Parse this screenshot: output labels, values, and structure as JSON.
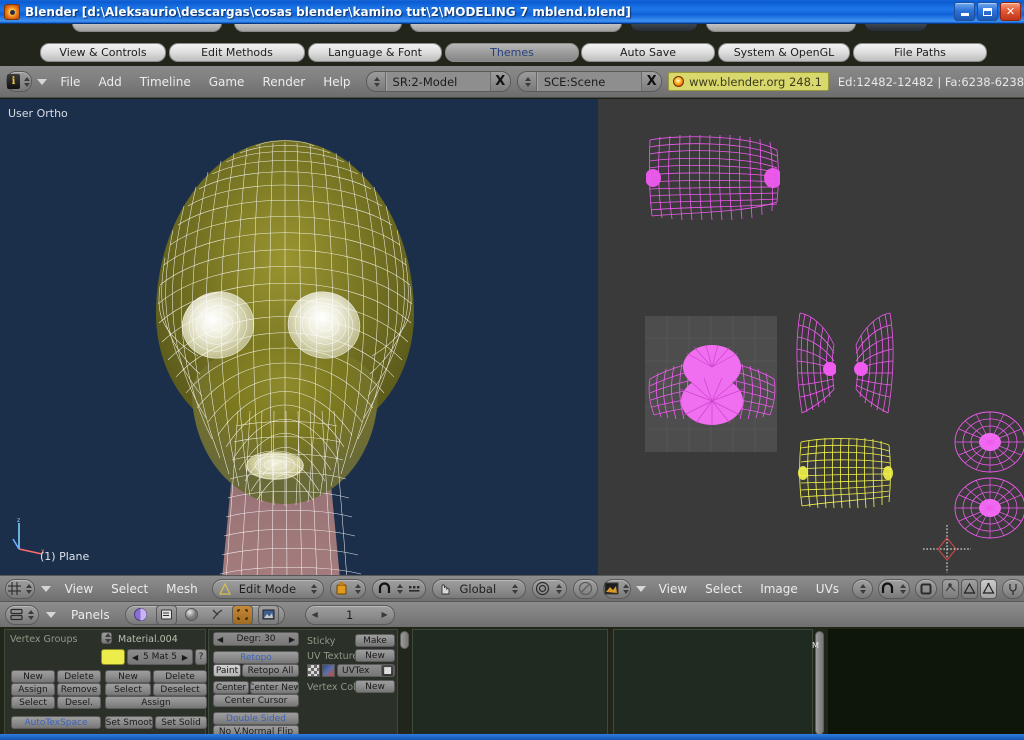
{
  "window": {
    "title": "Blender [d:\\Aleksaurio\\descargas\\cosas blender\\kamino tut\\2\\MODELING 7 mblend.blend]",
    "app_icon": "blender-logo-icon",
    "controls": {
      "minimize": "minimize-button",
      "restore": "restore-button",
      "close": "✕"
    }
  },
  "prefs_tabs": {
    "items": [
      {
        "label": "View & Controls",
        "active": false
      },
      {
        "label": "Edit Methods",
        "active": false
      },
      {
        "label": "Language & Font",
        "active": false
      },
      {
        "label": "Themes",
        "active": true
      },
      {
        "label": "Auto Save",
        "active": false
      },
      {
        "label": "System & OpenGL",
        "active": false
      },
      {
        "label": "File Paths",
        "active": false
      }
    ]
  },
  "main_header": {
    "window_type_icon": "info-window-icon",
    "menus": [
      "File",
      "Add",
      "Timeline",
      "Game",
      "Render",
      "Help"
    ],
    "screen_field": {
      "value": "SR:2-Model",
      "clear": "X"
    },
    "scene_field": {
      "value": "SCE:Scene",
      "clear": "X"
    },
    "version_badge": "www.blender.org 248.1",
    "stats": "Ed:12482-12482 | Fa:6238-6238"
  },
  "viewport3d": {
    "view_label": "User Ortho",
    "object_label": "(1) Plane",
    "background_color": "#1b2f4b",
    "mesh_color": "#7f7c26",
    "wire_color": "#ffffff",
    "neck_color": "#9b7577",
    "header": {
      "window_type_icon": "3d-view-icon",
      "menus": [
        "View",
        "Select",
        "Mesh"
      ],
      "mode": {
        "label": "Edit Mode",
        "icon": "edit-mode-icon"
      },
      "draw_type_icon": "shading-solid-icon",
      "snap_icon": "magnet-icon",
      "proportional_icon": "proportional-edit-icon",
      "pivot_icon": "manipulator-hand-icon",
      "transform_orientation": "Global",
      "widget_icon": "rotate-manipulator-icon",
      "occlude_icon": "occlude-geometry-icon"
    }
  },
  "uv_editor": {
    "background_color": "#3a3a3a",
    "uv_square_color": "#4d4d4d",
    "island_color": "#ef5aef",
    "selected_island_color": "#f2f24a",
    "header": {
      "window_type_icon": "uv-image-editor-icon",
      "menus": [
        "View",
        "Select",
        "Image",
        "UVs"
      ],
      "image_browse_icon": "browse-image-icon",
      "pin_icon": "image-pin-icon",
      "realtime_icon": "realtime-texture-icon",
      "uvsnap_icon": "uv-snap-icon",
      "face_select_icon": "face-select-icon",
      "vertex_select_icon": "uv-vertex-select-icon",
      "paint_icon": "image-paint-icon"
    }
  },
  "buttons_window": {
    "header": {
      "window_type_icon": "buttons-window-icon",
      "panels_label": "Panels",
      "icons": [
        "shading-icon",
        "object-buttons-icon",
        "material-icon",
        "physics-icon",
        "editing-icon",
        "texture-face-icon"
      ],
      "frame_value": "1",
      "frame_prev": "◀",
      "frame_next": "▶"
    },
    "link_materials_panel": {
      "vertex_groups_label": "Vertex Groups",
      "material_name": "Material.004",
      "material_index": "5 Mat 5",
      "question_btn": "?",
      "vg_buttons": [
        [
          "New",
          "Delete"
        ],
        [
          "Assign",
          "Remove"
        ],
        [
          "Select",
          "Desel."
        ]
      ],
      "mat_buttons": [
        [
          "New",
          "Delete"
        ],
        [
          "Select",
          "Deselect"
        ]
      ],
      "mat_assign": "Assign",
      "autotexspace": "AutoTexSpace",
      "set_smooth": "Set Smoot",
      "set_solid": "Set Solid"
    },
    "mesh_panel": {
      "degr": "Degr: 30",
      "retopo": "Retopo",
      "paint": "Paint",
      "retopo_all": "Retopo All",
      "center": "Center",
      "center_new": "Center New",
      "center_cursor": "Center Cursor",
      "double_sided": "Double Sided",
      "no_vnormal_flip": "No V.Normal Flip"
    },
    "uv_panel": {
      "sticky_label": "Sticky",
      "sticky_btn": "Make",
      "uv_texture_label": "UV Texture",
      "uv_texture_btn": "New",
      "uv_layer_name": "UVTex",
      "vertex_color_label": "Vertex Color",
      "vertex_color_btn": "New"
    }
  },
  "colors": {
    "title_blue": "#1060d8",
    "header_grey": "#808080",
    "blender_bg": "#22251a",
    "accent_yellow": "#d8d86c"
  }
}
